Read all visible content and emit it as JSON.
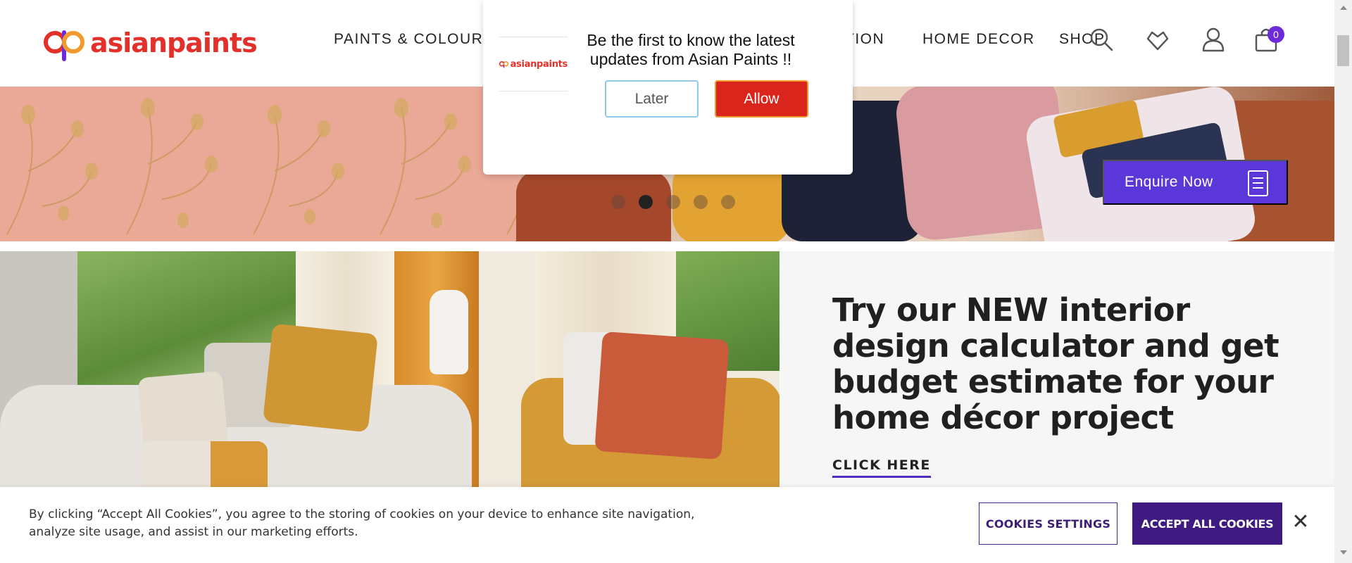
{
  "header": {
    "logo_text": "asianpaints",
    "nav": [
      "PAINTS & COLOURS",
      "TION",
      "HOME DECOR",
      "SHOP"
    ],
    "cart_count": "0",
    "icons": [
      "search-icon",
      "wishlist-heart-icon",
      "user-icon",
      "cart-bag-icon"
    ]
  },
  "push_popup": {
    "logo_text": "asianpaints",
    "message": "Be the first to know the latest updates from Asian Paints !!",
    "later_label": "Later",
    "allow_label": "Allow"
  },
  "hero": {
    "enquire_label": "Enquire Now",
    "slide_count": 5,
    "active_slide": 2
  },
  "promo": {
    "title": "Try our NEW interior design calculator and get budget estimate for your home décor project",
    "link_label": "CLICK HERE"
  },
  "cookie_banner": {
    "text": "By clicking “Accept All Cookies”, you agree to the storing of cookies on your device to enhance site navigation, analyze site usage, and assist in our marketing efforts.",
    "settings_label": "COOKIES SETTINGS",
    "accept_label": "ACCEPT ALL COOKIES",
    "close_label": "✕"
  },
  "colors": {
    "brand_red": "#e4302a",
    "accent_purple": "#5b36d8",
    "cookie_purple": "#3f1a80",
    "allow_red": "#d9251c"
  }
}
